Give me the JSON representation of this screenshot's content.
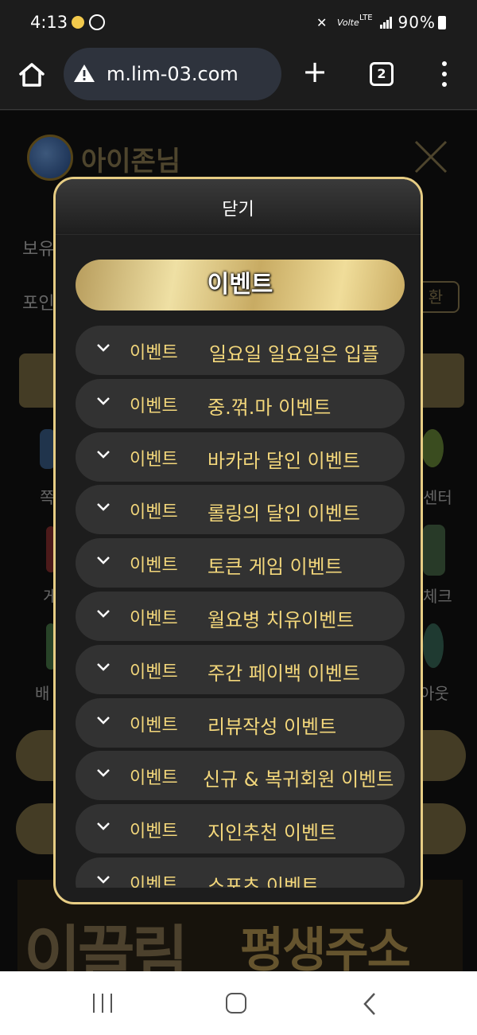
{
  "status_bar": {
    "time": "4:13",
    "volte": "Volte",
    "lte": "LTE",
    "battery": "90%"
  },
  "browser": {
    "url": "m.lim-03.com",
    "tab_count": "2",
    "new_tab": "+"
  },
  "background_page": {
    "username": "아이존님",
    "holding_label": "보유",
    "point_label": "포인",
    "convert_button": "환",
    "side_labels": [
      "쪽",
      "센터",
      "게",
      "체크",
      "배",
      "아웃"
    ],
    "banner_left": "이끌림",
    "banner_right": "평생주소"
  },
  "modal": {
    "close_label": "닫기",
    "title": "이벤트",
    "items": [
      {
        "category": "이벤트",
        "title": "일요일 일요일은 입플"
      },
      {
        "category": "이벤트",
        "title": "중.꺾.마 이벤트"
      },
      {
        "category": "이벤트",
        "title": "바카라 달인 이벤트"
      },
      {
        "category": "이벤트",
        "title": "롤링의 달인 이벤트"
      },
      {
        "category": "이벤트",
        "title": "토큰 게임 이벤트"
      },
      {
        "category": "이벤트",
        "title": "월요병 치유이벤트"
      },
      {
        "category": "이벤트",
        "title": "주간 페이백 이벤트"
      },
      {
        "category": "이벤트",
        "title": "리뷰작성 이벤트"
      },
      {
        "category": "이벤트",
        "title": "신규 & 복귀회원 이벤트"
      },
      {
        "category": "이벤트",
        "title": "지인추천 이벤트"
      },
      {
        "category": "이벤트",
        "title": "스포츠 이벤트"
      }
    ]
  },
  "colors": {
    "accent_gold": "#e7cd84",
    "item_text": "#f3d77b",
    "item_bg": "#323232"
  }
}
